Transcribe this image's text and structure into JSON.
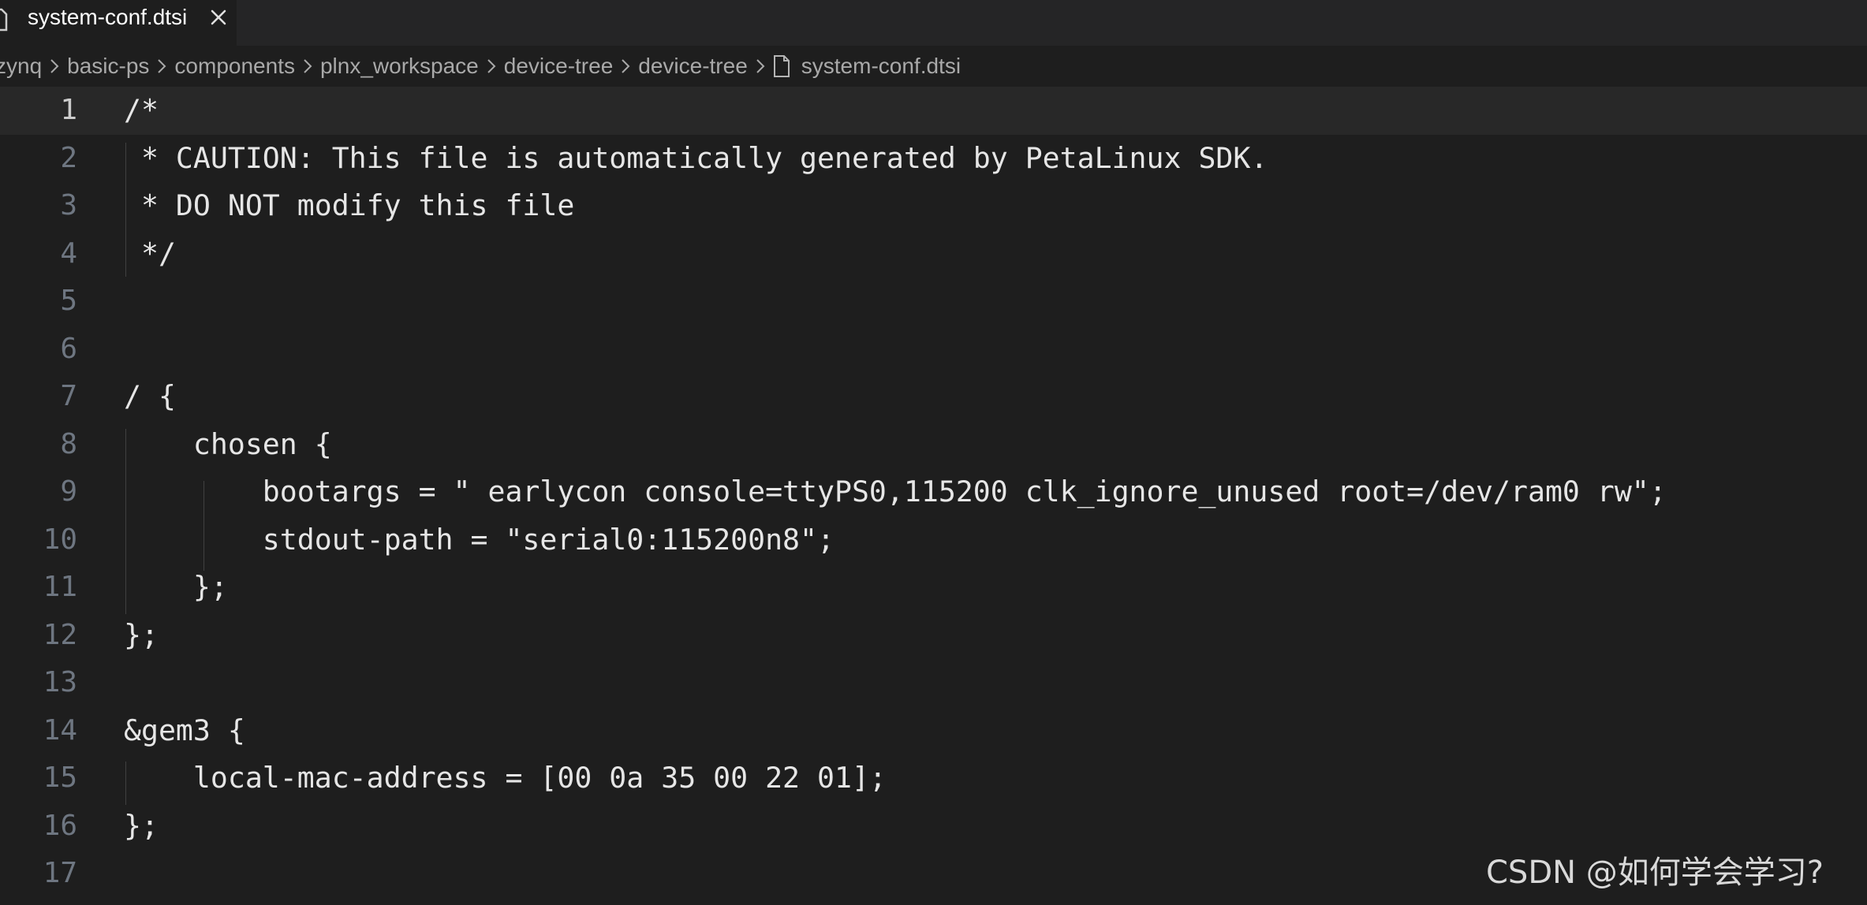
{
  "tab": {
    "label": "system-conf.dtsi",
    "file_icon": "file-icon",
    "close_icon": "close-icon"
  },
  "breadcrumb": {
    "items": [
      "zynq",
      "basic-ps",
      "components",
      "plnx_workspace",
      "device-tree",
      "device-tree",
      "system-conf.dtsi"
    ],
    "separator_icon": "chevron-right-icon",
    "file_icon": "file-icon"
  },
  "editor": {
    "current_line": 1,
    "lines": [
      {
        "num": "1",
        "text": "/*"
      },
      {
        "num": "2",
        "text": " * CAUTION: This file is automatically generated by PetaLinux SDK."
      },
      {
        "num": "3",
        "text": " * DO NOT modify this file"
      },
      {
        "num": "4",
        "text": " */"
      },
      {
        "num": "5",
        "text": ""
      },
      {
        "num": "6",
        "text": ""
      },
      {
        "num": "7",
        "text": "/ {"
      },
      {
        "num": "8",
        "text": "    chosen {"
      },
      {
        "num": "9",
        "text": "        bootargs = \" earlycon console=ttyPS0,115200 clk_ignore_unused root=/dev/ram0 rw\";"
      },
      {
        "num": "10",
        "text": "        stdout-path = \"serial0:115200n8\";"
      },
      {
        "num": "11",
        "text": "    };"
      },
      {
        "num": "12",
        "text": "};"
      },
      {
        "num": "13",
        "text": ""
      },
      {
        "num": "14",
        "text": "&gem3 {"
      },
      {
        "num": "15",
        "text": "    local-mac-address = [00 0a 35 00 22 01];"
      },
      {
        "num": "16",
        "text": "};"
      },
      {
        "num": "17",
        "text": ""
      }
    ]
  },
  "watermark": "CSDN @如何学会学习?",
  "colors": {
    "background": "#1e1e1e",
    "tabbar": "#252526",
    "text": "#e6e6e6",
    "line_number": "#6e7681",
    "current_line_number": "#cccccc",
    "current_line_highlight": "#282828",
    "breadcrumb_text": "#a9a9a9"
  }
}
